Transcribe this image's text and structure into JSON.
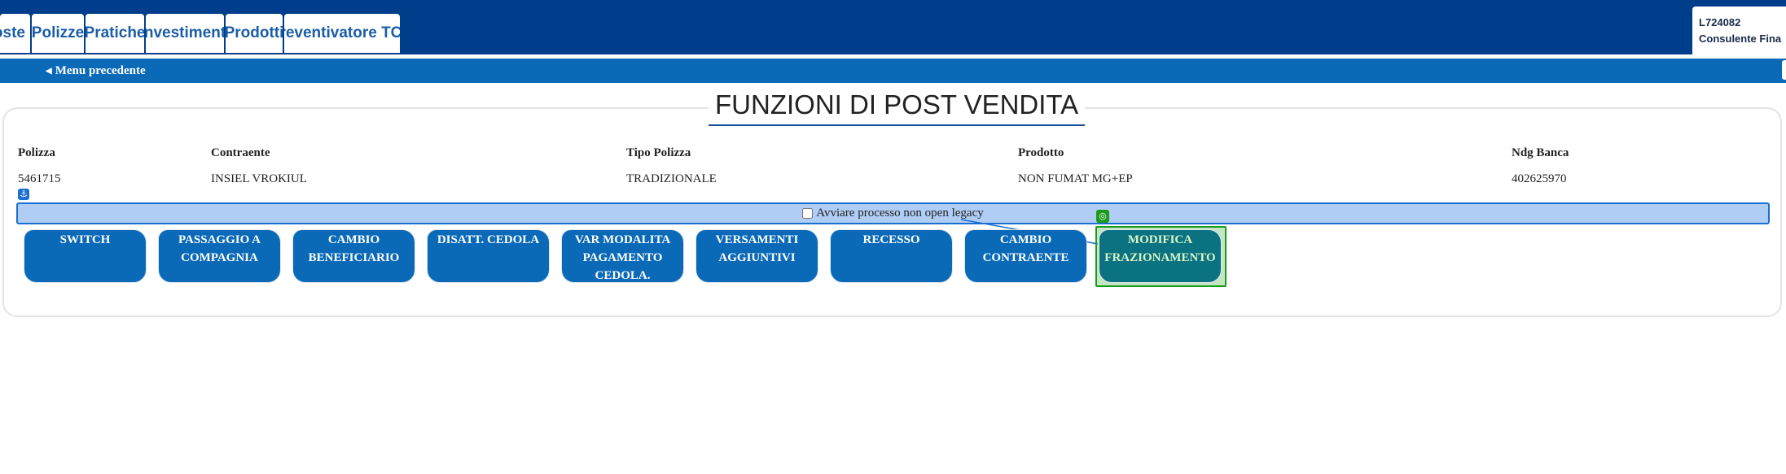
{
  "tabs": [
    {
      "label": "oste"
    },
    {
      "label": "Polizze"
    },
    {
      "label": "Pratiche"
    },
    {
      "label": "Investimenti"
    },
    {
      "label": "Prodotti"
    },
    {
      "label": "Preventivatore TCM"
    }
  ],
  "user": {
    "id": "L724082",
    "role": "Consulente Fina"
  },
  "subbar": {
    "back_label": "Menu precedente"
  },
  "page": {
    "title": "FUNZIONI DI POST VENDITA"
  },
  "policy": {
    "headers": [
      "Polizza",
      "Contraente",
      "Tipo Polizza",
      "Prodotto",
      "Ndg Banca"
    ],
    "values": [
      "5461715",
      "INSIEL VROKIUL",
      "TRADIZIONALE",
      "NON FUMAT MG+EP",
      "402625970"
    ]
  },
  "legacy": {
    "label": "Avviare processo non open legacy",
    "checked": false
  },
  "functions": [
    {
      "label": "SWITCH"
    },
    {
      "label": "PASSAGGIO A COMPAGNIA"
    },
    {
      "label": "CAMBIO BENEFICIARIO"
    },
    {
      "label": "DISATT. CEDOLA"
    },
    {
      "label": "VAR MODALITA PAGAMENTO CEDOLA."
    },
    {
      "label": "VERSAMENTI AGGIUNTIVI"
    },
    {
      "label": "RECESSO"
    },
    {
      "label": "CAMBIO CONTRAENTE"
    },
    {
      "label": "MODIFICA FRAZIONAMENTO"
    }
  ],
  "colors": {
    "header_blue": "#003d8a",
    "subbar_blue": "#0a6ab8",
    "button_blue": "#0a6ab8",
    "selection_green": "#1a9a1a"
  },
  "icons": {
    "anchor": "anchor-icon",
    "target": "target-icon",
    "back": "caret-left-icon"
  }
}
